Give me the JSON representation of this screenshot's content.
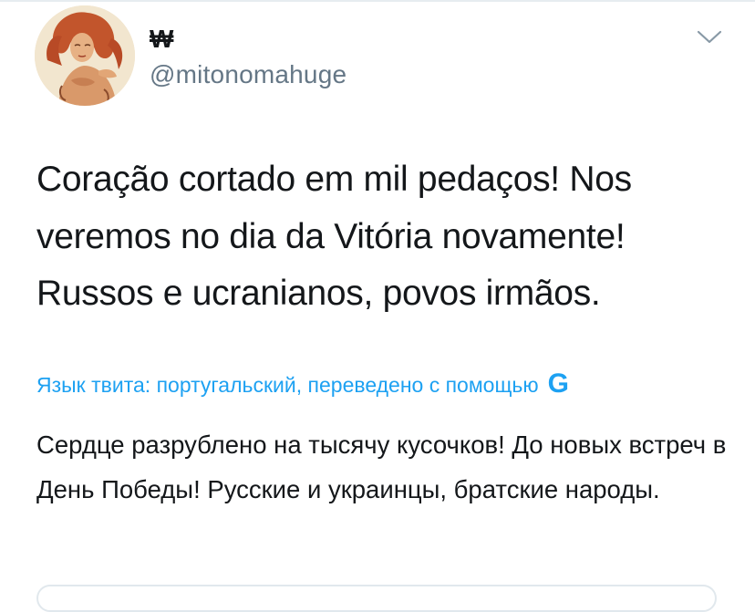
{
  "author": {
    "display_name": "₩",
    "handle": "@mitonomahuge",
    "avatar_icon": "avatar-illustration-icon"
  },
  "menu": {
    "caret_icon": "chevron-down-icon"
  },
  "tweet": {
    "text": "Coração cortado em mil pedaços! Nos veremos no dia da Vitória novamente! Russos e ucranianos, povos irmãos."
  },
  "translation": {
    "label": "Язык твита: португальский, переведено с помощью",
    "provider_logo": "G",
    "text": "Сердце разрублено на тысячу кусочков! До новых встреч в День Победы! Русские и украинцы, братские народы."
  },
  "colors": {
    "link": "#1da1f2",
    "secondary_text": "#657786",
    "primary_text": "#14171a",
    "divider": "#e6ecf0"
  }
}
